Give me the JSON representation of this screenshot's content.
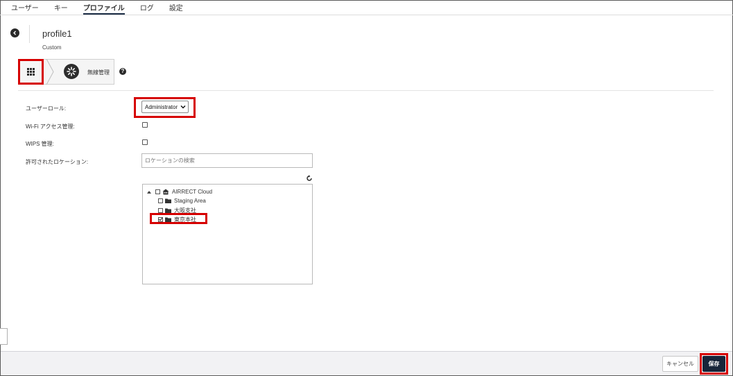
{
  "nav": {
    "tabs": [
      {
        "label": "ユーザー"
      },
      {
        "label": "キー"
      },
      {
        "label": "プロファイル",
        "active": true
      },
      {
        "label": "ログ"
      },
      {
        "label": "設定"
      }
    ]
  },
  "header": {
    "title": "profile1",
    "subtitle": "Custom"
  },
  "stepper": {
    "step2_label": "無線管理",
    "help_glyph": "?"
  },
  "form": {
    "user_role_label": "ユーザーロール:",
    "user_role_value": "Administrator",
    "wifi_access_label": "Wi-Fi アクセス管理:",
    "wips_label": "WIPS 管理:",
    "locations_label": "許可されたロケーション:",
    "location_search_placeholder": "ロケーションの検索"
  },
  "tree": {
    "root": {
      "label": "AIRRECT Cloud",
      "checked": false
    },
    "children": [
      {
        "label": "Staging Area",
        "checked": false
      },
      {
        "label": "大阪支社",
        "checked": false
      },
      {
        "label": "東京本社",
        "checked": true
      }
    ]
  },
  "footer": {
    "cancel_label": "キャンセル",
    "save_label": "保存"
  },
  "colors": {
    "accent_dark": "#16253a",
    "highlight_red": "#d60000"
  }
}
